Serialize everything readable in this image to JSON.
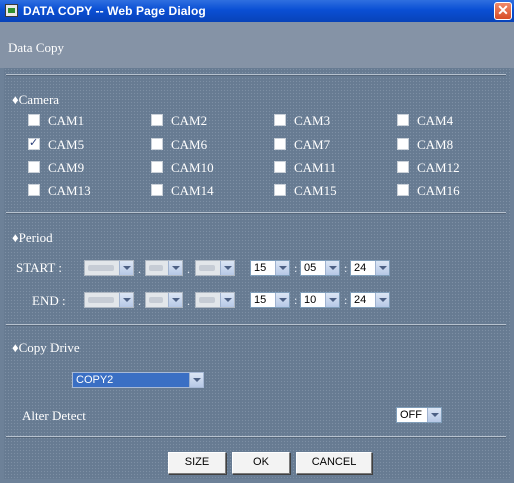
{
  "window": {
    "title": "DATA COPY -- Web Page Dialog",
    "close_glyph": "✕"
  },
  "header": {
    "title": "Data Copy"
  },
  "camera": {
    "label": "♦Camera",
    "items": [
      {
        "label": "CAM1",
        "checked": false
      },
      {
        "label": "CAM2",
        "checked": false
      },
      {
        "label": "CAM3",
        "checked": false
      },
      {
        "label": "CAM4",
        "checked": false
      },
      {
        "label": "CAM5",
        "checked": true
      },
      {
        "label": "CAM6",
        "checked": false
      },
      {
        "label": "CAM7",
        "checked": false
      },
      {
        "label": "CAM8",
        "checked": false
      },
      {
        "label": "CAM9",
        "checked": false
      },
      {
        "label": "CAM10",
        "checked": false
      },
      {
        "label": "CAM11",
        "checked": false
      },
      {
        "label": "CAM12",
        "checked": false
      },
      {
        "label": "CAM13",
        "checked": false
      },
      {
        "label": "CAM14",
        "checked": false
      },
      {
        "label": "CAM15",
        "checked": false
      },
      {
        "label": "CAM16",
        "checked": false
      }
    ]
  },
  "period": {
    "label": "♦Period",
    "start": {
      "label": "START :",
      "hour": "15",
      "minute": "05",
      "second": "24"
    },
    "end": {
      "label": "END :",
      "hour": "15",
      "minute": "10",
      "second": "24"
    },
    "date_sep": ".",
    "time_sep": ":"
  },
  "copy_drive": {
    "label": "♦Copy Drive",
    "drive": "COPY2",
    "alter_detect_label": "Alter Detect",
    "alter_detect_value": "OFF"
  },
  "buttons": {
    "size": "SIZE",
    "ok": "OK",
    "cancel": "CANCEL"
  },
  "colors": {
    "titlebar": "#0a4fd4",
    "background": "#677b92",
    "header": "#8593a6",
    "drive_select": "#3a6fc4"
  }
}
